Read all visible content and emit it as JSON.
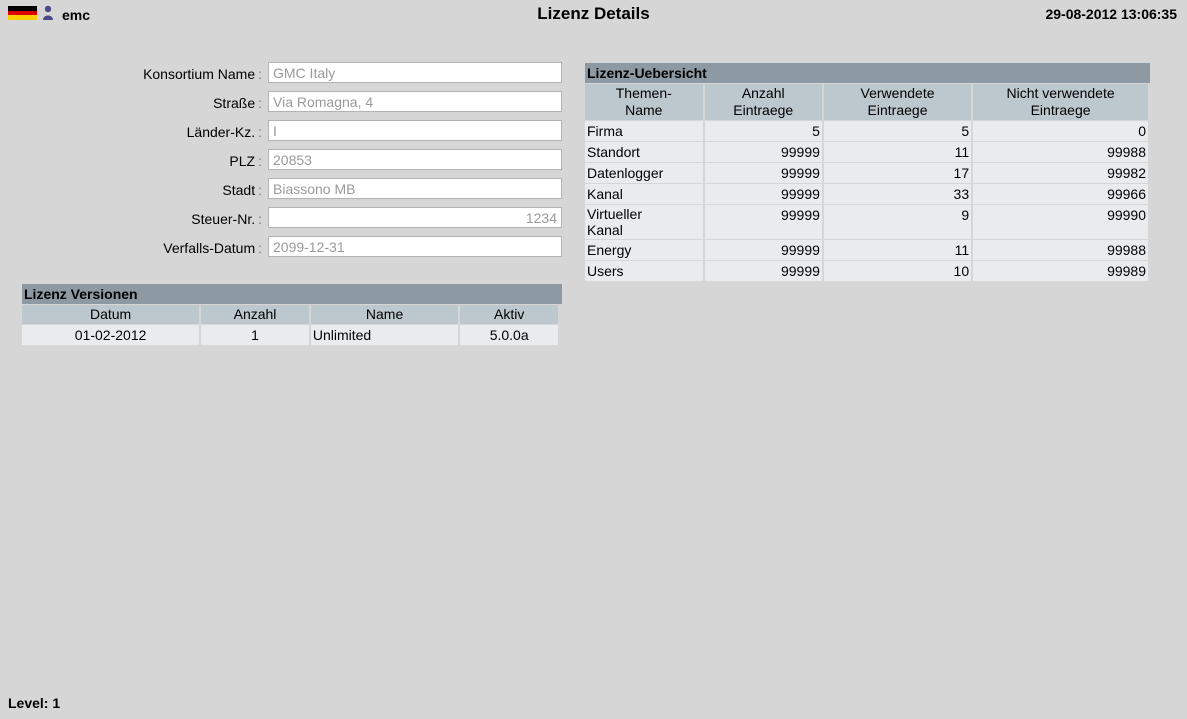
{
  "header": {
    "username": "emc",
    "title": "Lizenz Details",
    "datetime": "29-08-2012 13:06:35",
    "flag_colors": [
      "#000000",
      "#dd0000",
      "#ffce00"
    ]
  },
  "form": {
    "fields": [
      {
        "label": "Konsortium Name",
        "value": "GMC Italy"
      },
      {
        "label": "Straße",
        "value": "Via Romagna, 4"
      },
      {
        "label": "Länder-Kz.",
        "value": "I"
      },
      {
        "label": "PLZ",
        "value": "20853"
      },
      {
        "label": "Stadt",
        "value": "Biassono MB"
      },
      {
        "label": "Steuer-Nr.",
        "value": "1234"
      },
      {
        "label": "Verfalls-Datum",
        "value": "2099-12-31"
      }
    ]
  },
  "versions": {
    "title": "Lizenz Versionen",
    "headers": [
      "Datum",
      "Anzahl",
      "Name",
      "Aktiv"
    ],
    "rows": [
      [
        "01-02-2012",
        "1",
        "Unlimited",
        "5.0.0a"
      ]
    ]
  },
  "overview": {
    "title": "Lizenz-Uebersicht",
    "headers": [
      "Themen-\nName",
      "Anzahl\nEintraege",
      "Verwendete\nEintraege",
      "Nicht verwendete\nEintraege"
    ],
    "rows": [
      [
        "Firma",
        "5",
        "5",
        "0"
      ],
      [
        "Standort",
        "99999",
        "11",
        "99988"
      ],
      [
        "Datenlogger",
        "99999",
        "17",
        "99982"
      ],
      [
        "Kanal",
        "99999",
        "33",
        "99966"
      ],
      [
        "Virtueller\nKanal",
        "99999",
        "9",
        "99990"
      ],
      [
        "Energy",
        "99999",
        "11",
        "99988"
      ],
      [
        "Users",
        "99999",
        "10",
        "99989"
      ]
    ]
  },
  "footer": {
    "level": "Level: 1"
  }
}
